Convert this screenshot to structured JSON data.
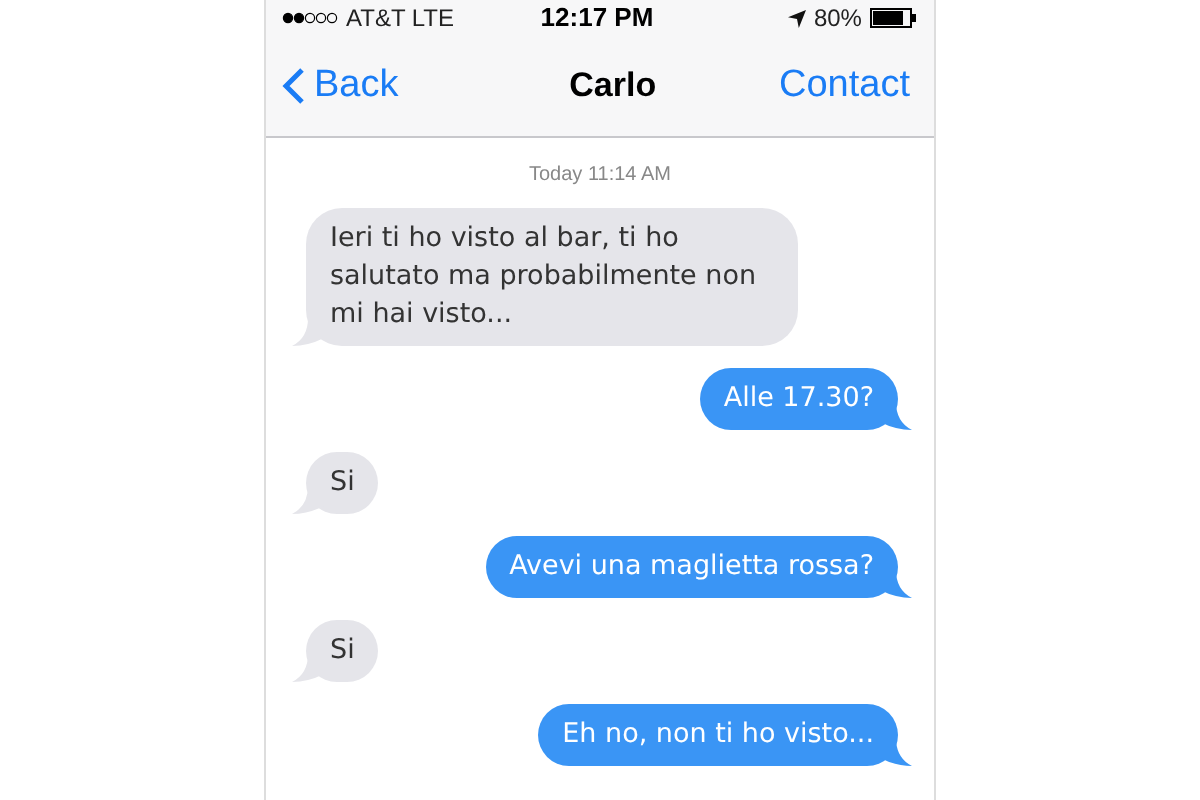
{
  "status_bar": {
    "carrier": "AT&T LTE",
    "time": "12:17 PM",
    "battery": "80%"
  },
  "nav_bar": {
    "back": "Back",
    "title": "Carlo",
    "action": "Contact"
  },
  "timestamp": "Today 11:14 AM",
  "messages": [
    {
      "kind": "incoming",
      "text": "Ieri ti ho visto al bar, ti ho salutato ma probabilmente non mi hai visto..."
    },
    {
      "kind": "outgoing",
      "text": "Alle 17.30?"
    },
    {
      "kind": "incoming",
      "text": "Si"
    },
    {
      "kind": "outgoing",
      "text": "Avevi una maglietta rossa?"
    },
    {
      "kind": "incoming",
      "text": "Si"
    },
    {
      "kind": "outgoing",
      "text": "Eh no, non ti ho visto..."
    }
  ]
}
